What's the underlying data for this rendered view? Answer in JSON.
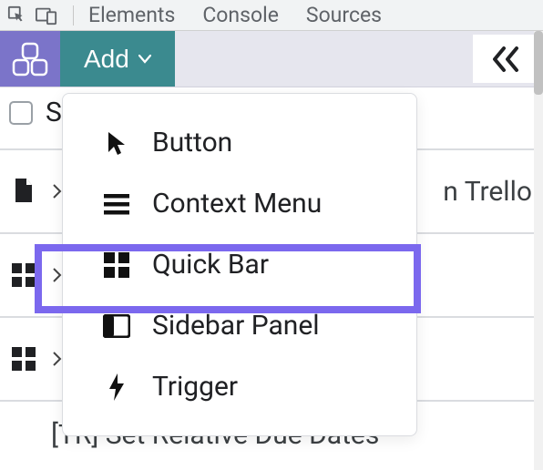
{
  "devtools": {
    "tabs": [
      "Elements",
      "Console",
      "Sources"
    ]
  },
  "toolbar": {
    "add_label": "Add"
  },
  "menu": {
    "items": [
      {
        "label": "Button"
      },
      {
        "label": "Context Menu"
      },
      {
        "label": "Quick Bar"
      },
      {
        "label": "Sidebar Panel"
      },
      {
        "label": "Trigger"
      }
    ]
  },
  "list": {
    "header_initial": "S",
    "rows": [
      {
        "text": "n Trello"
      },
      {
        "text": ""
      },
      {
        "text": ""
      }
    ],
    "partial_caption": "[TR] Set Relative Due Dates"
  }
}
